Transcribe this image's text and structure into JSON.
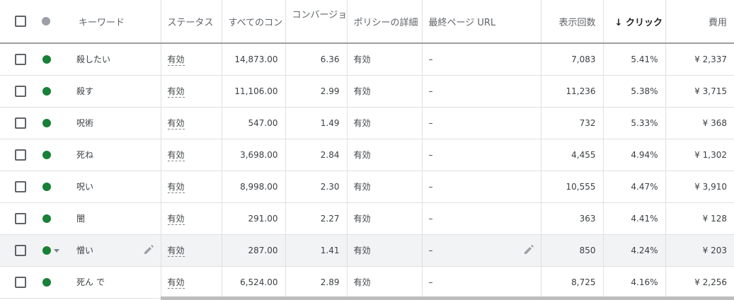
{
  "headers": {
    "keyword": "キーワード",
    "status": "ステータス",
    "all_conv": "すべてのコン",
    "conversions": "コンバージョ",
    "policy": "ポリシーの詳細",
    "final_url": "最終ページ URL",
    "impressions": "表示回数",
    "sort_arrow": "↓",
    "ctr": "クリック",
    "cost": "費用"
  },
  "rows": [
    {
      "keyword": "殺したい",
      "status": "有効",
      "all_conv": "14,873.00",
      "conv": "6.36",
      "policy": "有効",
      "url": "–",
      "impr": "7,083",
      "ctr": "5.41%",
      "cost": "¥ 2,337"
    },
    {
      "keyword": "殺す",
      "status": "有効",
      "all_conv": "11,106.00",
      "conv": "2.99",
      "policy": "有効",
      "url": "–",
      "impr": "11,236",
      "ctr": "5.38%",
      "cost": "¥ 3,715"
    },
    {
      "keyword": "呪術",
      "status": "有効",
      "all_conv": "547.00",
      "conv": "1.49",
      "policy": "有効",
      "url": "–",
      "impr": "732",
      "ctr": "5.33%",
      "cost": "¥ 368"
    },
    {
      "keyword": "死ね",
      "status": "有効",
      "all_conv": "3,698.00",
      "conv": "2.84",
      "policy": "有効",
      "url": "–",
      "impr": "4,455",
      "ctr": "4.94%",
      "cost": "¥ 1,302"
    },
    {
      "keyword": "呪い",
      "status": "有効",
      "all_conv": "8,998.00",
      "conv": "2.30",
      "policy": "有効",
      "url": "–",
      "impr": "10,555",
      "ctr": "4.47%",
      "cost": "¥ 3,910"
    },
    {
      "keyword": "闇",
      "status": "有効",
      "all_conv": "291.00",
      "conv": "2.27",
      "policy": "有効",
      "url": "–",
      "impr": "363",
      "ctr": "4.41%",
      "cost": "¥ 128"
    },
    {
      "keyword": "憎い",
      "status": "有効",
      "all_conv": "287.00",
      "conv": "1.41",
      "policy": "有効",
      "url": "–",
      "impr": "850",
      "ctr": "4.24%",
      "cost": "¥ 203"
    },
    {
      "keyword": "死ん で",
      "status": "有効",
      "all_conv": "6,524.00",
      "conv": "2.89",
      "policy": "有効",
      "url": "–",
      "impr": "8,725",
      "ctr": "4.16%",
      "cost": "¥ 2,256"
    }
  ],
  "colors": {
    "enabled_dot": "#188038",
    "header_dot": "#9aa0a6",
    "hover_row": "#f1f3f4"
  },
  "icons": {
    "edit": "pencil-icon",
    "row_status": "status-dot-icon",
    "dropdown": "caret-down-icon",
    "sort": "sort-down-arrow"
  }
}
